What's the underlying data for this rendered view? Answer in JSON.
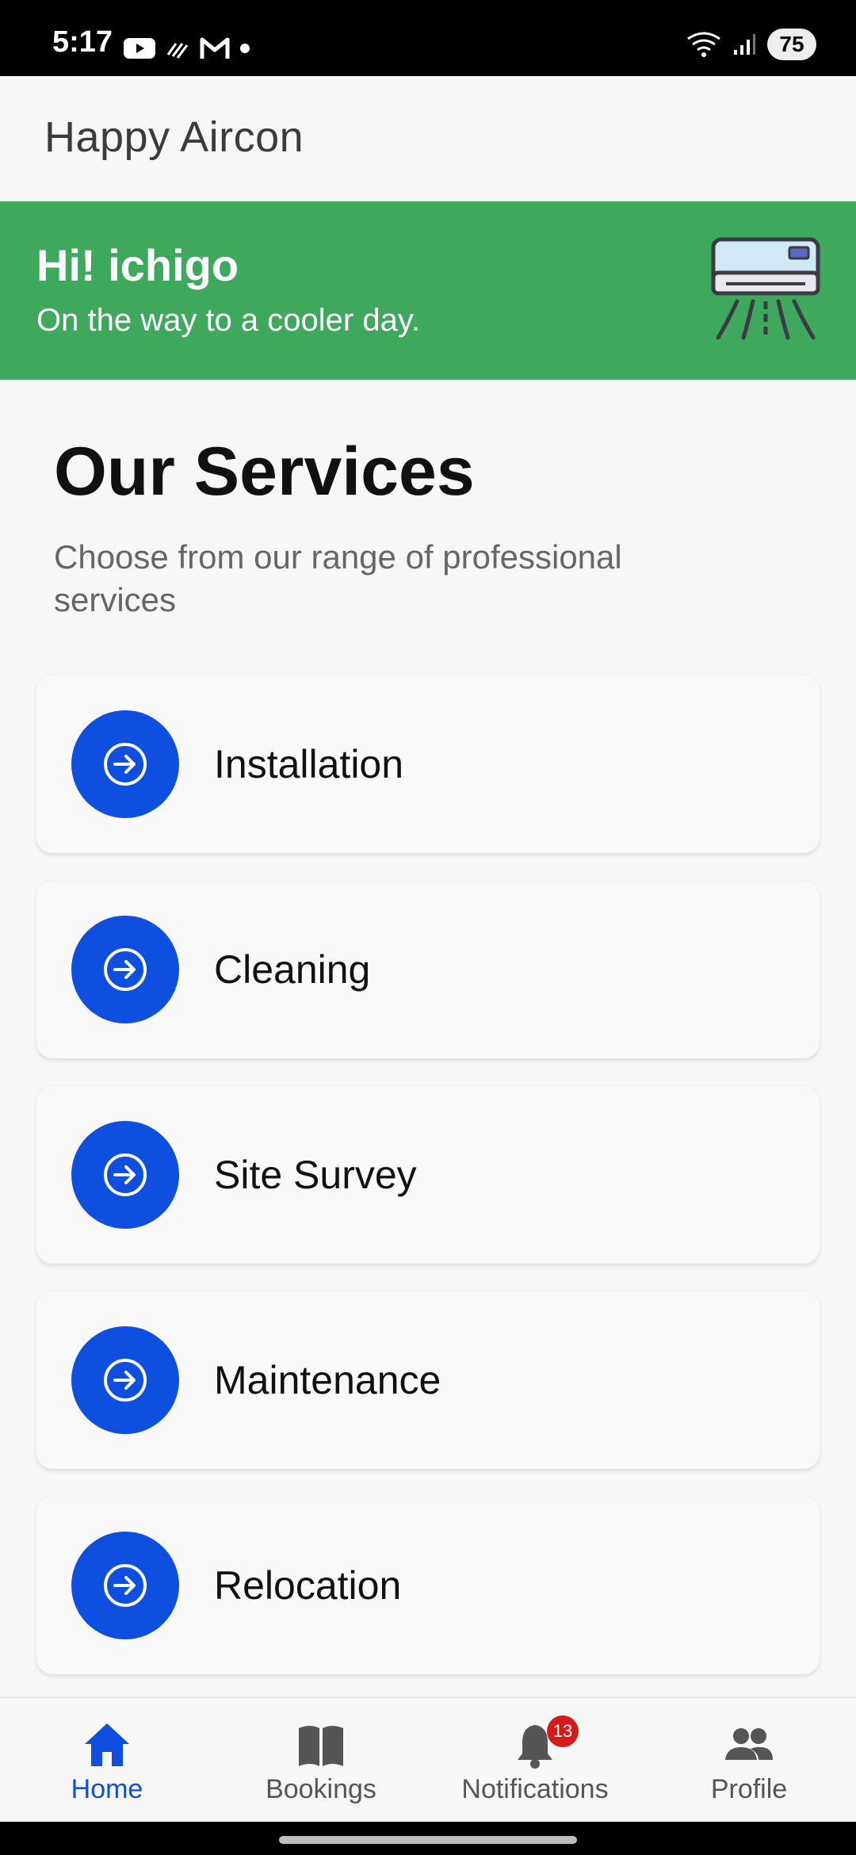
{
  "status_bar": {
    "time": "5:17",
    "battery": "75",
    "icons_left": [
      "youtube-icon",
      "signal-lines-icon",
      "gmail-icon",
      "dot-icon"
    ],
    "icons_right": [
      "wifi-icon",
      "cellular-signal-icon",
      "battery-icon"
    ]
  },
  "app_bar": {
    "title": "Happy Aircon"
  },
  "banner": {
    "greeting": "Hi! ichigo",
    "subtitle": "On the way to a cooler day.",
    "background_color": "#3ea85c",
    "illustration": "air-conditioner-icon"
  },
  "services": {
    "title": "Our Services",
    "subtitle": "Choose from our range of professional services",
    "accent_color": "#0e4fe0",
    "items": [
      {
        "label": "Installation",
        "icon": "arrow-right-circle-icon"
      },
      {
        "label": "Cleaning",
        "icon": "arrow-right-circle-icon"
      },
      {
        "label": "Site Survey",
        "icon": "arrow-right-circle-icon"
      },
      {
        "label": "Maintenance",
        "icon": "arrow-right-circle-icon"
      },
      {
        "label": "Relocation",
        "icon": "arrow-right-circle-icon"
      }
    ]
  },
  "bottom_nav": {
    "items": [
      {
        "label": "Home",
        "icon": "home-icon",
        "active": true
      },
      {
        "label": "Bookings",
        "icon": "book-icon",
        "active": false
      },
      {
        "label": "Notifications",
        "icon": "bell-icon",
        "active": false,
        "badge": "13"
      },
      {
        "label": "Profile",
        "icon": "people-icon",
        "active": false
      }
    ]
  }
}
